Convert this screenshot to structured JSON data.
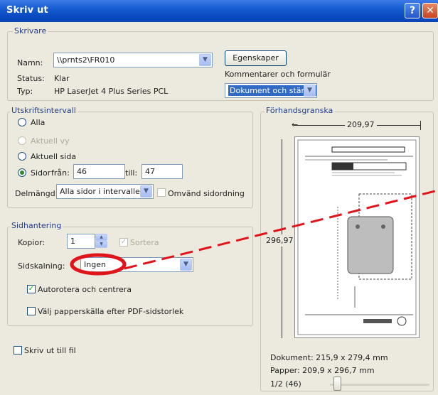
{
  "window": {
    "title": "Skriv ut",
    "help_icon": "question-icon",
    "close_icon": "close-icon"
  },
  "printer": {
    "group_label": "Skrivare",
    "name_label": "Namn:",
    "name_value": "\\\\prnts2\\FR010",
    "properties_button": "Egenskaper",
    "status_label": "Status:",
    "status_value": "Klar",
    "type_label": "Typ:",
    "type_value": "HP LaserJet 4 Plus Series PCL",
    "comments_label": "Kommentarer och formulär",
    "comments_value": "Dokument och stämplar"
  },
  "range": {
    "group_label": "Utskriftsintervall",
    "all": "Alla",
    "current_view": "Aktuell vy",
    "current_page": "Aktuell sida",
    "pages": "Sidor",
    "from_label": "från:",
    "from_value": "46",
    "to_label": "till:",
    "to_value": "47",
    "subset_label": "Delmängd:",
    "subset_value": "Alla sidor i intervallet",
    "reverse_label": "Omvänd sidordning"
  },
  "handling": {
    "group_label": "Sidhantering",
    "copies_label": "Kopior:",
    "copies_value": "1",
    "collate_label": "Sortera",
    "scaling_label": "Sidskalning:",
    "scaling_value": "Ingen",
    "autorotate_label": "Autorotera och centrera",
    "paper_source_label": "Välj papperskälla efter PDF-sidstorlek"
  },
  "print_to_file": "Skriv ut till fil",
  "preview": {
    "group_label": "Förhandsgranska",
    "width_value": "209,97",
    "height_value": "296,97",
    "document_label": "Dokument: 215,9 x 279,4 mm",
    "paper_label": "Papper: 209,9 x 296,7 mm",
    "page_counter": "1/2 (46)",
    "page_icon": "page-preview-icon"
  },
  "annotation": {
    "color": "#e0151c",
    "highlight_icon": "ellipse-highlight-icon"
  }
}
